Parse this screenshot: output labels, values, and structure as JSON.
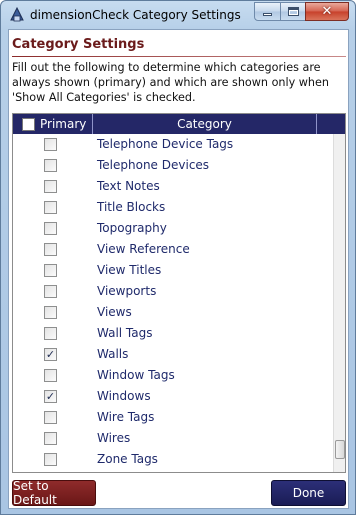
{
  "window": {
    "title": "dimensionCheck Category Settings",
    "close_glyph": "✕"
  },
  "header": {
    "title": "Category Settings",
    "description": "Fill out the following to determine which categories are always shown (primary) and which are shown only when 'Show All Categories' is checked."
  },
  "grid": {
    "columns": {
      "primary": "Primary",
      "category": "Category"
    },
    "header_checked": false,
    "rows": [
      {
        "category": "Telephone Device Tags",
        "primary": false
      },
      {
        "category": "Telephone Devices",
        "primary": false
      },
      {
        "category": "Text Notes",
        "primary": false
      },
      {
        "category": "Title Blocks",
        "primary": false
      },
      {
        "category": "Topography",
        "primary": false
      },
      {
        "category": "View Reference",
        "primary": false
      },
      {
        "category": "View Titles",
        "primary": false
      },
      {
        "category": "Viewports",
        "primary": false
      },
      {
        "category": "Views",
        "primary": false
      },
      {
        "category": "Wall Tags",
        "primary": false
      },
      {
        "category": "Walls",
        "primary": true
      },
      {
        "category": "Window Tags",
        "primary": false
      },
      {
        "category": "Windows",
        "primary": true
      },
      {
        "category": "Wire Tags",
        "primary": false
      },
      {
        "category": "Wires",
        "primary": false
      },
      {
        "category": "Zone Tags",
        "primary": false
      }
    ],
    "check_glyph": "✓"
  },
  "buttons": {
    "set_default": "Set to Default",
    "done": "Done"
  },
  "colors": {
    "accent_red": "#6b1b1b",
    "header_navy": "#242767",
    "category_text": "#1f2a6b"
  },
  "icons": {
    "app": "revit-app-icon",
    "minimize": "minimize-icon",
    "maximize": "maximize-icon",
    "close": "close-icon"
  }
}
